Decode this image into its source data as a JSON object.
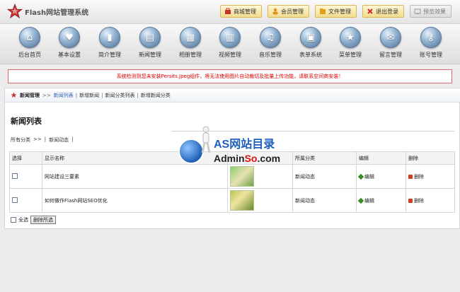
{
  "header": {
    "app_title": "Flash网站管理系统",
    "buttons": [
      {
        "label": "商城管理",
        "icon": "shop-icon"
      },
      {
        "label": "会员管理",
        "icon": "member-icon"
      },
      {
        "label": "文件管理",
        "icon": "file-icon"
      },
      {
        "label": "退出登录",
        "icon": "logout-icon"
      },
      {
        "label": "预览效果",
        "icon": "preview-icon"
      }
    ]
  },
  "nav": {
    "items": [
      {
        "label": "后台首页",
        "icon": "home-icon",
        "glyph": "⌂"
      },
      {
        "label": "基本设置",
        "icon": "settings-icon",
        "glyph": "♥"
      },
      {
        "label": "简介管理",
        "icon": "intro-icon",
        "glyph": "▮"
      },
      {
        "label": "新闻管理",
        "icon": "news-icon",
        "glyph": "▤"
      },
      {
        "label": "相册管理",
        "icon": "album-icon",
        "glyph": "▦"
      },
      {
        "label": "视频管理",
        "icon": "video-icon",
        "glyph": "▥"
      },
      {
        "label": "音乐管理",
        "icon": "music-icon",
        "glyph": "♫"
      },
      {
        "label": "表单系统",
        "icon": "form-icon",
        "glyph": "▣"
      },
      {
        "label": "菜单管理",
        "icon": "menu-icon",
        "glyph": "★"
      },
      {
        "label": "留言管理",
        "icon": "message-icon",
        "glyph": "✉"
      },
      {
        "label": "账号管理",
        "icon": "account-icon",
        "glyph": "⚷"
      }
    ]
  },
  "warning": {
    "text": "系统检测到您未安装Persits.Jpeg组件，将无法使用图片自动裁切及批量上传功能，请联系空间商安装！"
  },
  "breadcrumb": {
    "section": "新闻管理",
    "arrow": ">>",
    "links": [
      "新闻列表",
      "新增新闻",
      "新闻分类列表",
      "新增新闻分类"
    ]
  },
  "main": {
    "title": "新闻列表",
    "filter": {
      "all": "所有分类",
      "arrow": ">>",
      "sep": "|",
      "category": "新闻动态",
      "end": "|"
    },
    "table": {
      "headers": [
        "选择",
        "显示名称",
        "",
        "所属分类",
        "编辑",
        "删除"
      ],
      "rows": [
        {
          "name": "网站建设三要素",
          "category": "新闻动态",
          "edit": "编辑",
          "delete": "删除"
        },
        {
          "name": "如何做作Flash网站SEO优化",
          "category": "新闻动态",
          "edit": "编辑",
          "delete": "删除"
        }
      ]
    },
    "select_all": "全选",
    "delete_selected": "删除所选"
  },
  "watermark": {
    "line1": "AS网站目录",
    "line2_a": "Admin",
    "line2_b": "So",
    "line2_c": ".com"
  },
  "colors": {
    "accent_blue": "#2761b3",
    "warning_red": "#d00000",
    "button_gold": "#f2dc8e"
  }
}
